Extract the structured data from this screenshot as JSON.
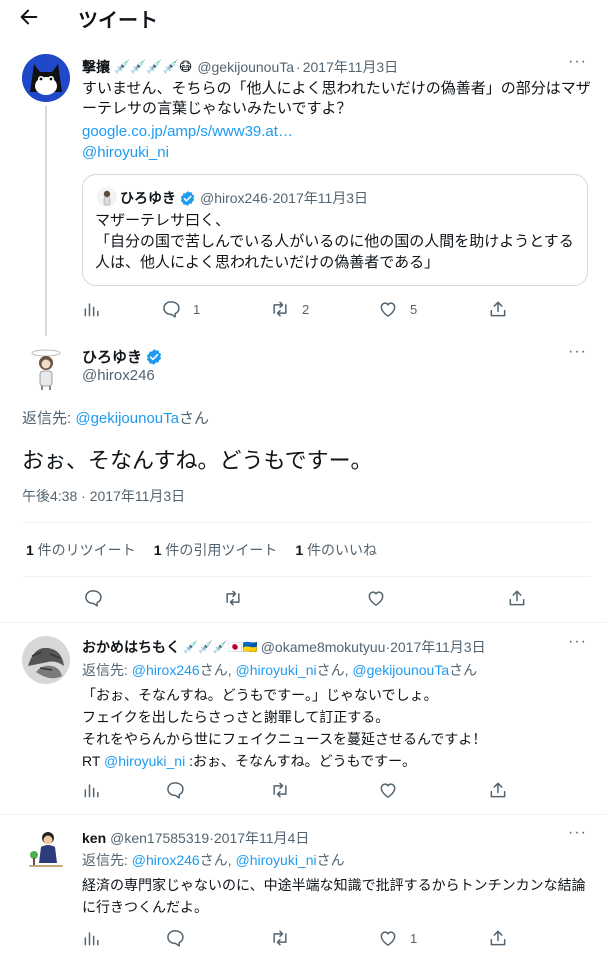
{
  "header": {
    "title": "ツイート"
  },
  "tweet1": {
    "name": "撃攘",
    "emojis": "💉💉💉💉😷",
    "handle": "@gekijounouTa",
    "date": "2017年11月3日",
    "text": "すいません、そちらの「他人によく思われたいだけの偽善者」の部分はマザーテレサの言葉じゃないみたいですよ？",
    "link": "google.co.jp/amp/s/www39.at…",
    "mention": "@hiroyuki_ni",
    "quote": {
      "name": "ひろゆき",
      "handle": "@hirox246",
      "date": "2017年11月3日",
      "text": "マザーテレサ曰く、\n「自分の国で苦しんでいる人がいるのに他の国の人間を助けようとする人は、他人によく思われたいだけの偽善者である」"
    },
    "replies": "1",
    "retweets": "2",
    "likes": "5"
  },
  "main": {
    "name": "ひろゆき",
    "handle": "@hirox246",
    "reply_to_prefix": "返信先: ",
    "reply_to_user": "@gekijounouTa",
    "reply_to_suffix": "さん",
    "text": "おぉ、そなんすね。どうもですー。",
    "timestamp": "午後4:38 · 2017年11月3日",
    "stats": [
      {
        "count": "1",
        "label": " 件のリツイート"
      },
      {
        "count": "1",
        "label": " 件の引用ツイート"
      },
      {
        "count": "1",
        "label": " 件のいいね"
      }
    ]
  },
  "tweet3": {
    "name": "おかめはちもく",
    "emojis": "💉💉💉🇯🇵🇺🇦",
    "handle": "@okame8mokutyuu",
    "date": "2017年11月3日",
    "reply_prefix": "返信先: ",
    "reply_users": [
      "@hirox246",
      "@hiroyuki_ni",
      "@gekijounouTa"
    ],
    "reply_sep": "さん, ",
    "reply_suffix": "さん",
    "line1": "「おぉ、そなんすね。どうもですー。」じゃないでしょ。",
    "line2": "フェイクを出したらさっさと謝罪して訂正する。",
    "line3": "それをやらんから世にフェイクニュースを蔓延させるんですよ！",
    "rt_prefix": "RT ",
    "rt_mention": "@hiroyuki_ni",
    "rt_text": " :おぉ、そなんすね。どうもですー。"
  },
  "tweet4": {
    "name": "ken",
    "handle": "@ken17585319",
    "date": "2017年11月4日",
    "reply_prefix": "返信先: ",
    "reply_users": [
      "@hirox246",
      "@hiroyuki_ni"
    ],
    "reply_sep": "さん, ",
    "reply_suffix": "さん",
    "text": "経済の専門家じゃないのに、中途半端な知識で批評するからトンチンカンな結論に行きつくんだよ。",
    "likes": "1"
  },
  "sep": " · ",
  "more_label": "···",
  "colors": {
    "accent": "#1d9bf0",
    "text": "#0f1419",
    "secondary": "#536471",
    "border": "#eff3f4",
    "verified": "#1d9bf0"
  }
}
